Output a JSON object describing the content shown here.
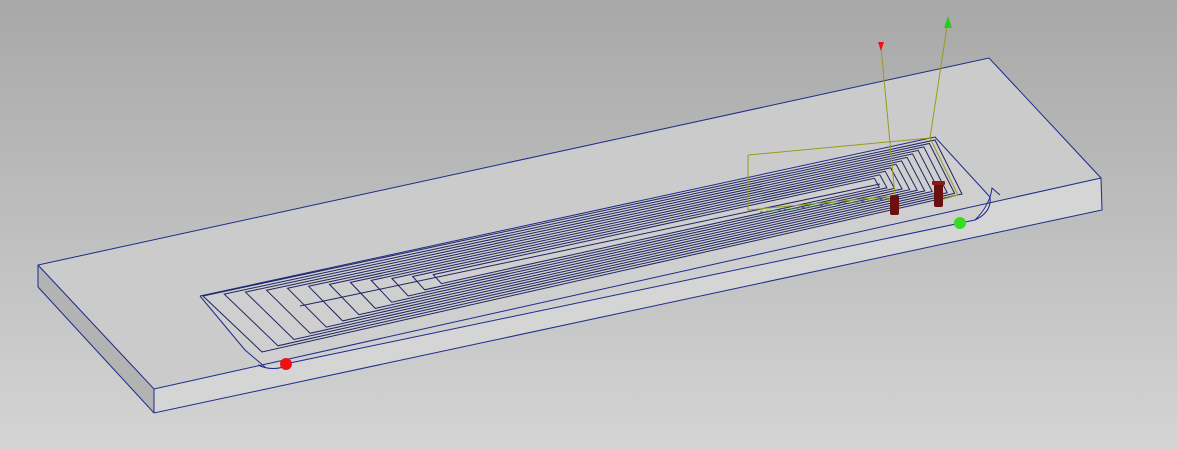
{
  "viewport": {
    "background_top": "#a8a8a8",
    "background_bottom": "#d4d4d4"
  },
  "colors": {
    "stock_top": "#cbcbcb",
    "stock_front": "#d5d5d5",
    "stock_left": "#b3b3b3",
    "pocket_floor": "#cfcfcf",
    "edge": "#1c2a8c",
    "toolpath": "#1e2460",
    "linking_move": "#9a9a1a",
    "rapid_dashed": "#2f8f2f",
    "tool_holder": "#6b1010",
    "start_point": "#ee1111",
    "end_point": "#33dd22",
    "axis_red": "#ee1111",
    "axis_green": "#22cc22"
  },
  "markers": {
    "start": "start-point-marker",
    "end": "end-point-marker"
  }
}
